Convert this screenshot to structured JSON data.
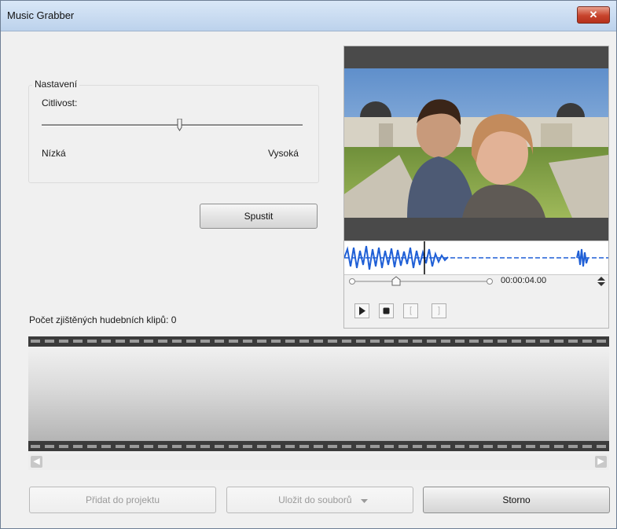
{
  "window": {
    "title": "Music Grabber",
    "close_glyph": "✕"
  },
  "settings": {
    "group_title": "Nastavení",
    "sensitivity_label": "Citlivost:",
    "sensitivity_level": 0.52,
    "low_label": "Nízká",
    "high_label": "Vysoká"
  },
  "start_button": "Spustit",
  "clips_count_label": "Počet zjištěných hudebních klipů: 0",
  "preview": {
    "timecode": "00:00:04.00",
    "playback_position": 0.35,
    "controls": {
      "play_icon": "play-icon",
      "stop_icon": "stop-icon",
      "mark_in": "[",
      "mark_out": "]"
    }
  },
  "footer": {
    "add_to_project": "Přidat do projektu",
    "save_to_files": "Uložit do souborů",
    "cancel": "Storno"
  },
  "colors": {
    "waveform": "#1f5fd6",
    "titlebar": "#c8dcf1",
    "close": "#c7432c"
  }
}
